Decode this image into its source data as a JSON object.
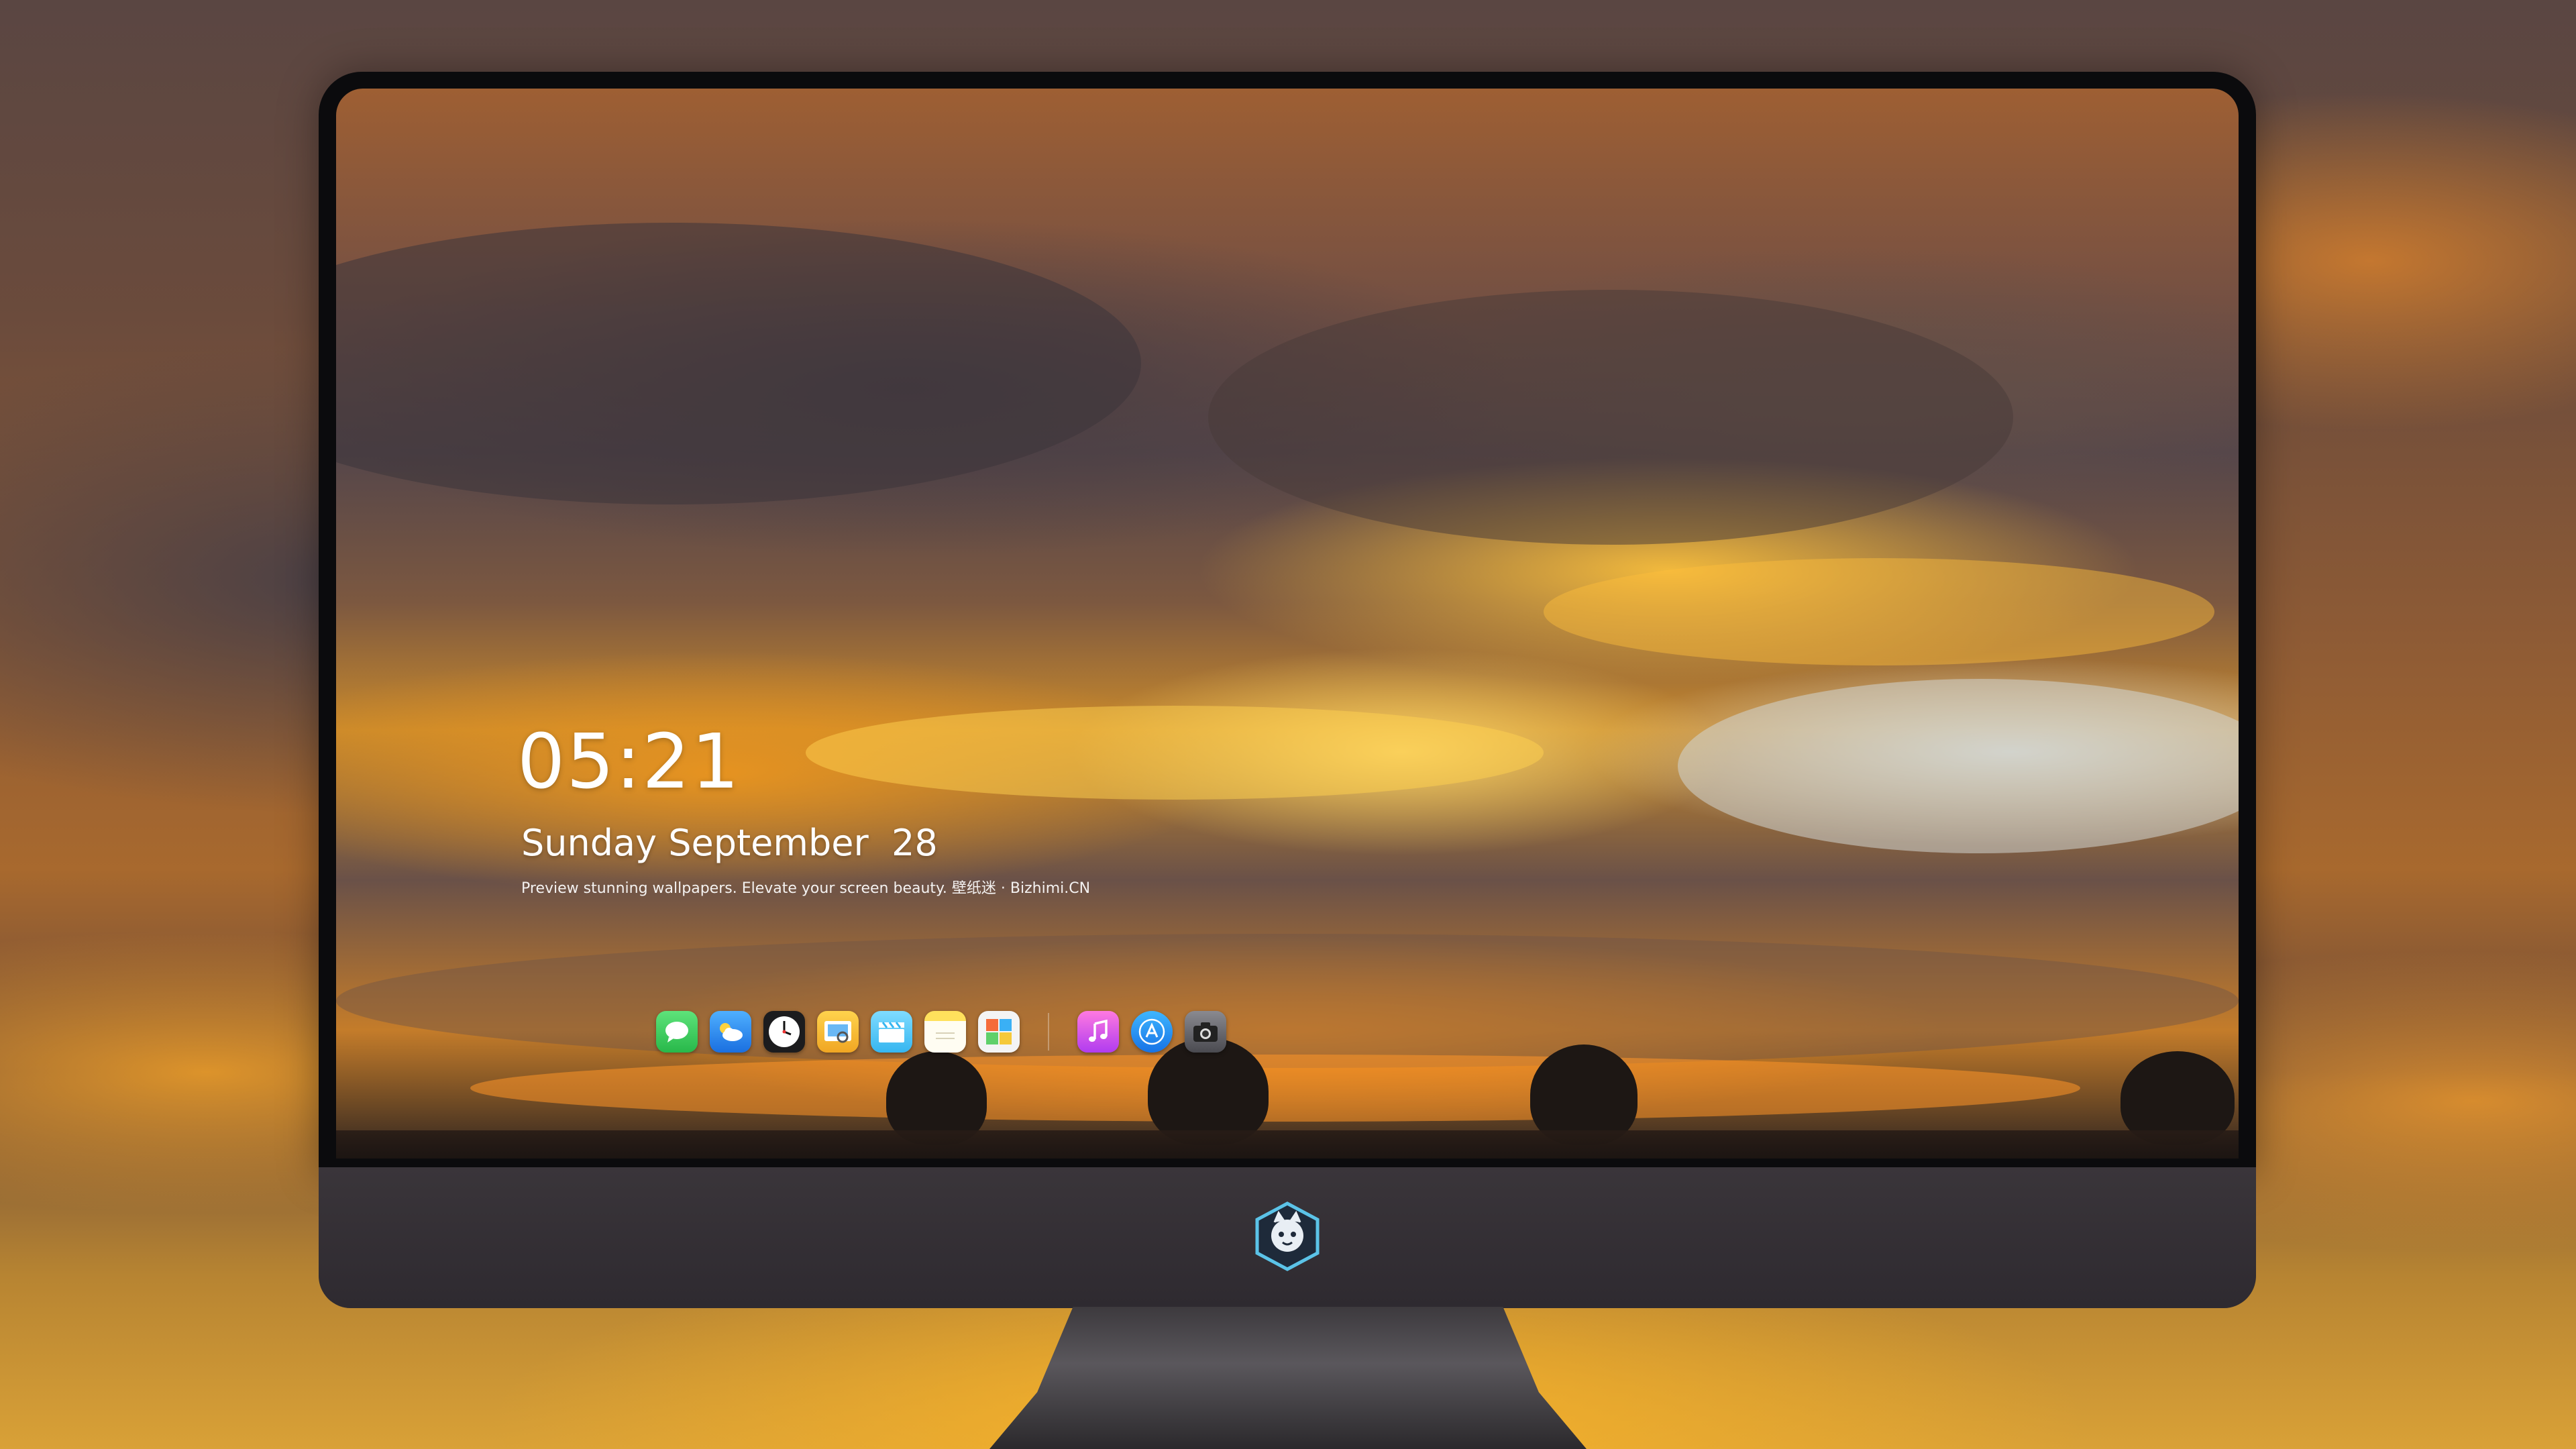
{
  "lock_screen": {
    "time": "05:21",
    "date": "Sunday September  28",
    "tagline": "Preview stunning wallpapers. Elevate your screen beauty. 壁纸迷 · Bizhimi.CN"
  },
  "dock": {
    "apps": [
      {
        "name": "messages",
        "icon": "chat-bubble-icon",
        "color": "#34c759"
      },
      {
        "name": "weather",
        "icon": "cloud-sun-icon",
        "color": "#2f8cf0"
      },
      {
        "name": "clock",
        "icon": "clock-icon",
        "color": "#f2f2f2"
      },
      {
        "name": "preview",
        "icon": "photo-viewer-icon",
        "color": "#f5c842"
      },
      {
        "name": "clips",
        "icon": "clapperboard-icon",
        "color": "#5ac8fa"
      },
      {
        "name": "notes",
        "icon": "notepad-icon",
        "color": "#fff3b0"
      },
      {
        "name": "photo-booth",
        "icon": "photo-grid-icon",
        "color": "#e9e9e9"
      },
      {
        "name": "music",
        "icon": "music-note-icon",
        "color": "#e652d9"
      },
      {
        "name": "app-store",
        "icon": "app-store-icon",
        "color": "#1d8cf8"
      },
      {
        "name": "camera",
        "icon": "camera-icon",
        "color": "#5b5b60"
      }
    ]
  },
  "colors": {
    "bezel": "#0b0b0d",
    "chin": "#3a353a",
    "sky_gold": "#f2a52e",
    "sky_cloud": "#55464a"
  },
  "monitor_logo": {
    "icon": "mascot-logo-icon"
  }
}
